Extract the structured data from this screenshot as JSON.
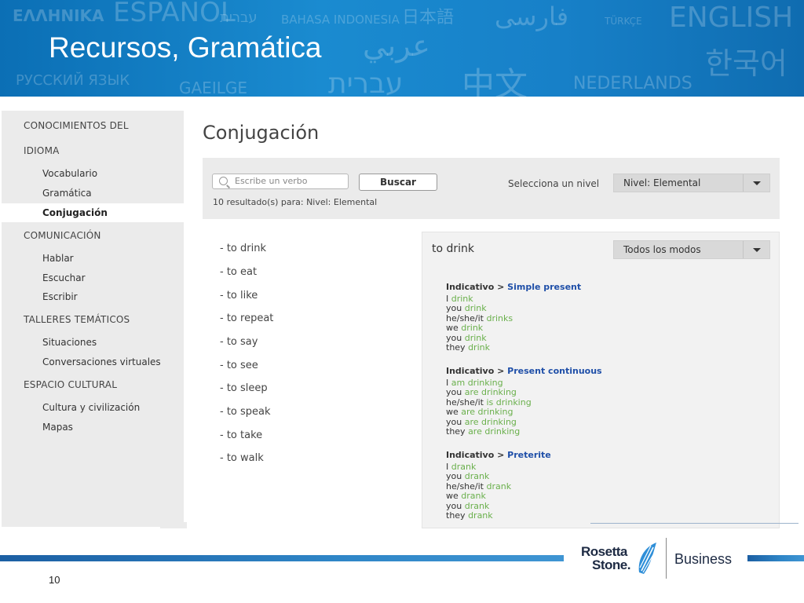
{
  "banner": {
    "title": "Recursos, Gramática",
    "languages": [
      "ΕΛΛΗΝΙΚΑ",
      "ESPAÑOL",
      "עברית",
      "BAHASA INDONESIA",
      "日本語",
      "فارسی",
      "TÜRKÇE",
      "ENGLISH",
      "عربي",
      "한국어",
      "РУССКИЙ ЯЗЫК",
      "GAEILGE",
      "עברית",
      "中文",
      "NEDERLANDS"
    ]
  },
  "sidebar": {
    "sections": [
      {
        "label": "CONOCIMIENTOS DEL",
        "label2": "IDIOMA",
        "items": [
          "Vocabulario",
          "Gramática",
          "Conjugación"
        ]
      },
      {
        "label": "COMUNICACIÓN",
        "items": [
          "Hablar",
          "Escuchar",
          "Escribir"
        ]
      },
      {
        "label": "TALLERES TEMÁTICOS",
        "items": [
          "Situaciones",
          "Conversaciones virtuales"
        ]
      },
      {
        "label": "ESPACIO CULTURAL",
        "items": [
          "Cultura y civilización",
          "Mapas"
        ]
      }
    ],
    "active_item": "Conjugación"
  },
  "main": {
    "title": "Conjugación",
    "search": {
      "placeholder": "Escribe un verbo",
      "button": "Buscar"
    },
    "level": {
      "label": "Selecciona un nivel",
      "value": "Nivel: Elemental"
    },
    "results_text": "10 resultado(s) para: Nivel: Elemental",
    "verbs": [
      "- to drink",
      "- to eat",
      "- to like",
      "- to repeat",
      "- to say",
      "- to see",
      "- to sleep",
      "- to speak",
      "- to take",
      "- to walk"
    ]
  },
  "detail": {
    "verb": "to drink",
    "mode_value": "Todos los modos",
    "blocks": [
      {
        "mood": "Indicativo",
        "tense": "Simple present",
        "rows": [
          [
            "I",
            "drink"
          ],
          [
            "you",
            "drink"
          ],
          [
            "he/she/it",
            "drinks"
          ],
          [
            "we",
            "drink"
          ],
          [
            "you",
            "drink"
          ],
          [
            "they",
            "drink"
          ]
        ]
      },
      {
        "mood": "Indicativo",
        "tense": "Present continuous",
        "rows": [
          [
            "I",
            "am drinking"
          ],
          [
            "you",
            "are drinking"
          ],
          [
            "he/she/it",
            "is drinking"
          ],
          [
            "we",
            "are drinking"
          ],
          [
            "you",
            "are drinking"
          ],
          [
            "they",
            "are drinking"
          ]
        ]
      },
      {
        "mood": "Indicativo",
        "tense": "Preterite",
        "rows": [
          [
            "I",
            "drank"
          ],
          [
            "you",
            "drank"
          ],
          [
            "he/she/it",
            "drank"
          ],
          [
            "we",
            "drank"
          ],
          [
            "you",
            "drank"
          ],
          [
            "they",
            "drank"
          ]
        ]
      }
    ]
  },
  "footer": {
    "logo_line1": "Rosetta",
    "logo_line2": "Stone.",
    "logo_business": "Business",
    "page_number": "10"
  },
  "colors": {
    "banner": "#1780c8",
    "tense_link": "#1f4fa8",
    "verb_form": "#6ab04c",
    "panel_grey": "#ebebeb"
  }
}
